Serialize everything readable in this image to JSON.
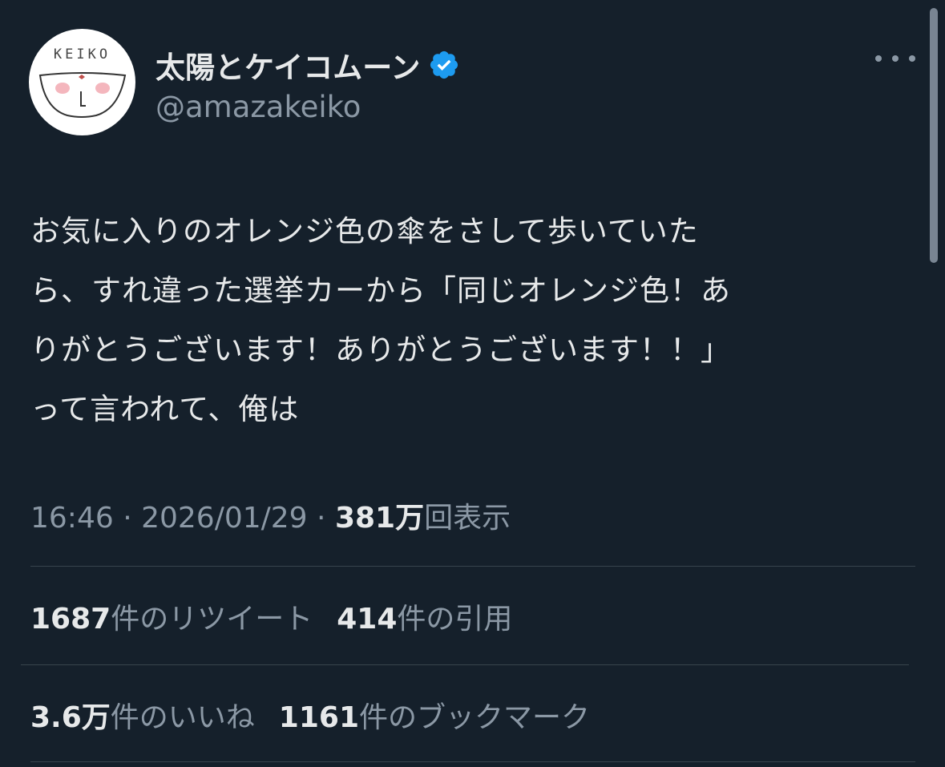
{
  "user": {
    "display_name": "太陽とケイコムーン",
    "handle": "@amazakeiko",
    "avatar_text": "KEIKO",
    "verified": true,
    "verified_color": "#1d9bf0"
  },
  "tweet": {
    "text": "お気に入りのオレンジ色の傘をさして歩いていた\nら、すれ違った選挙カーから「同じオレンジ色！あ\nりがとうございます！ありがとうございます！！」\nって言われて、俺は"
  },
  "meta": {
    "time": "16:46",
    "separator": " · ",
    "date": "2026/01/29",
    "views_value": "381万",
    "views_label": "回表示"
  },
  "stats": {
    "retweets_value": "1687",
    "retweets_label": "件のリツイート",
    "quotes_value": "414",
    "quotes_label": "件の引用",
    "likes_value": "3.6万",
    "likes_label": "件のいいね",
    "bookmarks_value": "1161",
    "bookmarks_label": "件のブックマーク"
  },
  "colors": {
    "background": "#15202b",
    "text": "#e7e9ea",
    "secondary": "#8b98a5",
    "divider": "#38444d"
  }
}
